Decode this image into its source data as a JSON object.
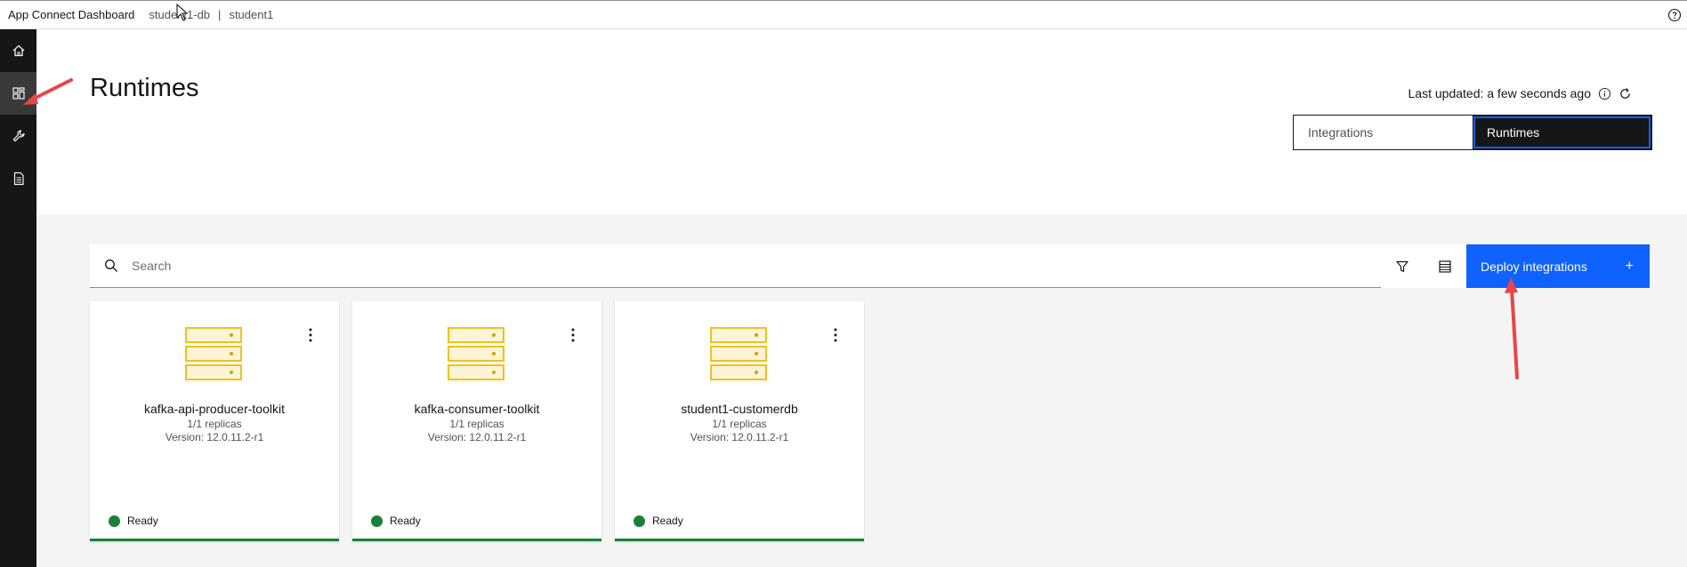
{
  "header": {
    "brand": "App Connect Dashboard",
    "crumbs": [
      "student1-db",
      "|",
      "student1"
    ]
  },
  "sidebar": {
    "items": [
      {
        "icon": "home-icon"
      },
      {
        "icon": "dashboard-icon",
        "active": true
      },
      {
        "icon": "wrench-icon"
      },
      {
        "icon": "document-icon"
      }
    ]
  },
  "page": {
    "title": "Runtimes",
    "last_updated": "Last updated: a few seconds ago"
  },
  "switcher": {
    "options": [
      "Integrations",
      "Runtimes"
    ],
    "selected": "Runtimes"
  },
  "toolbar": {
    "search_placeholder": "Search",
    "deploy_label": "Deploy integrations",
    "deploy_icon": "+"
  },
  "cards": [
    {
      "name": "kafka-api-producer-toolkit",
      "replicas": "1/1 replicas",
      "version": "Version: 12.0.11.2-r1",
      "status": "Ready"
    },
    {
      "name": "kafka-consumer-toolkit",
      "replicas": "1/1 replicas",
      "version": "Version: 12.0.11.2-r1",
      "status": "Ready"
    },
    {
      "name": "student1-customerdb",
      "replicas": "1/1 replicas",
      "version": "Version: 12.0.11.2-r1",
      "status": "Ready"
    }
  ],
  "colors": {
    "accent": "#0f62fe",
    "ready": "#198038",
    "server_icon": "#f1c21b",
    "annotation_arrow": "#e8454a"
  }
}
